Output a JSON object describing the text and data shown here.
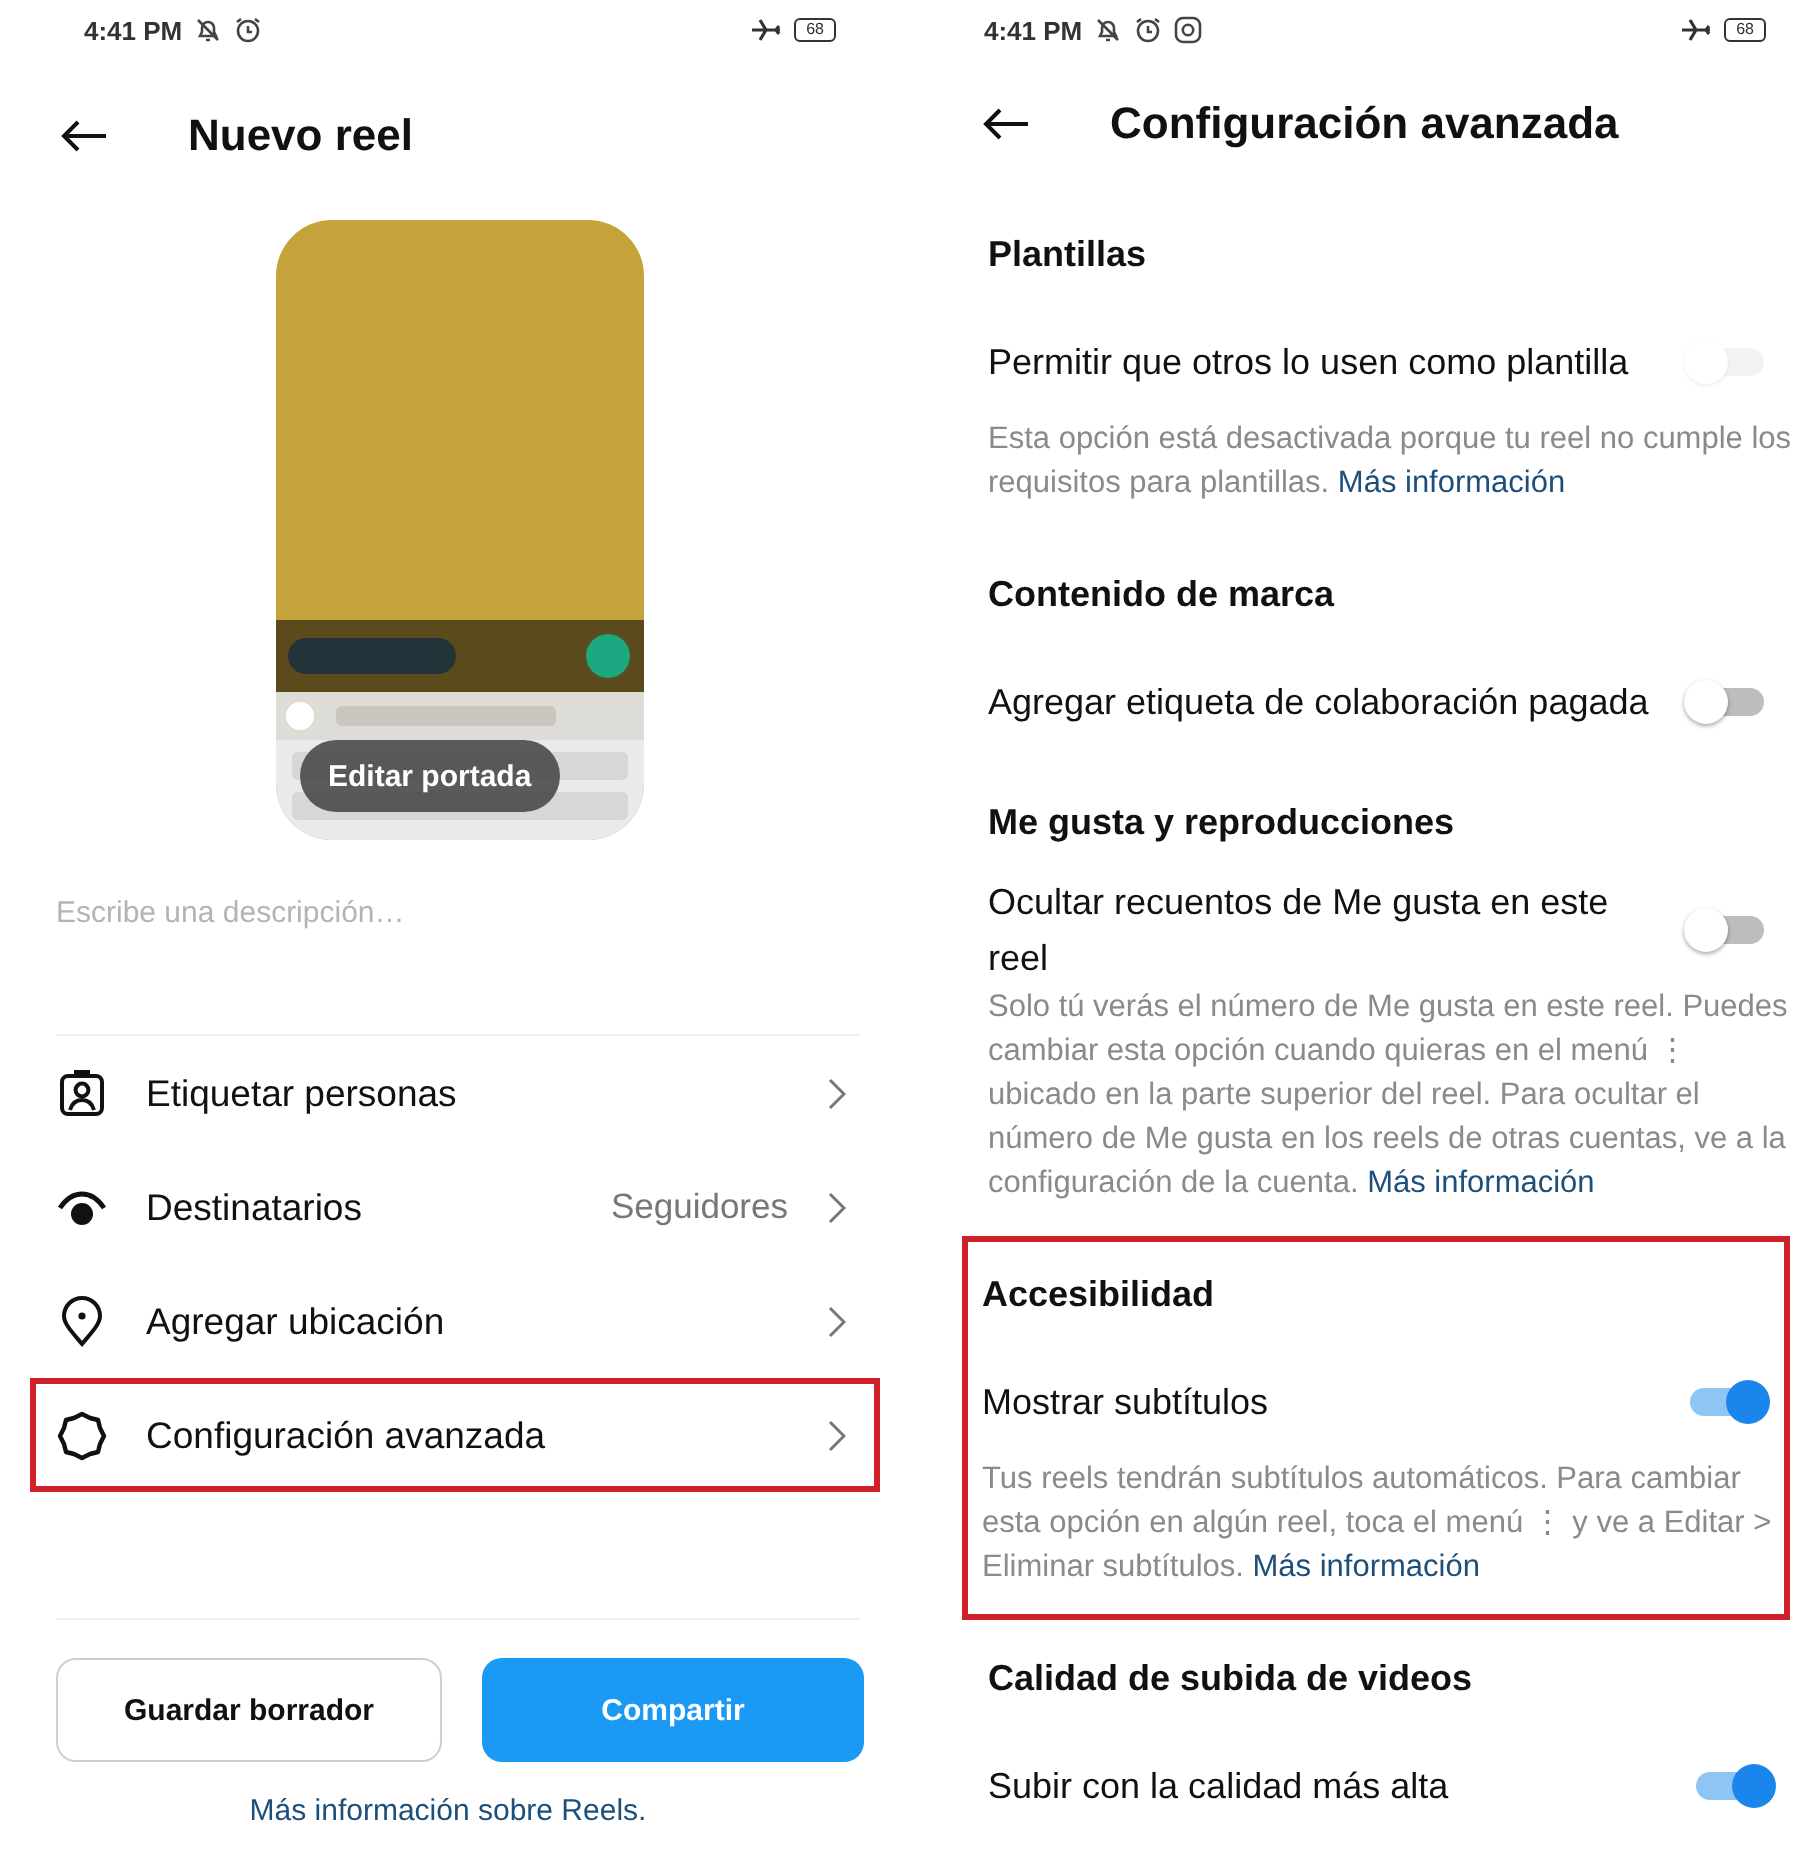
{
  "left": {
    "status_bar": {
      "time": "4:41 PM",
      "battery": "68"
    },
    "title": "Nuevo reel",
    "cover": {
      "kind": "picture",
      "button": "Editar portada"
    },
    "description": {
      "placeholder": "Escribe una descripción…"
    },
    "menu": [
      {
        "kind": "tag",
        "label": "Etiquetar personas",
        "highlighted": false
      },
      {
        "kind": "audience",
        "label": "Destinatarios",
        "value": "Seguidores",
        "highlighted": false
      },
      {
        "kind": "location",
        "label": "Agregar ubicación",
        "highlighted": false
      },
      {
        "kind": "advanced",
        "label": "Configuración avanzada",
        "highlighted": true
      }
    ],
    "buttons": [
      {
        "kind": "secondary",
        "label": "Guardar borrador"
      },
      {
        "kind": "primary",
        "label": "Compartir"
      }
    ],
    "footer_link": "Más información sobre Reels."
  },
  "right": {
    "status_bar": {
      "time": "4:41 PM",
      "battery": "68"
    },
    "title": "Configuración avanzada",
    "sections": [
      {
        "heading": "Plantillas",
        "highlighted": false,
        "settings": [
          {
            "label": "Permitir que otros lo usen como plantilla",
            "on": false,
            "disabled": true,
            "description": "Esta opción está desactivada porque tu reel no cumple los requisitos para plantillas.",
            "link": "Más información"
          }
        ]
      },
      {
        "heading": "Contenido de marca",
        "highlighted": false,
        "settings": [
          {
            "label": "Agregar etiqueta de colaboración pagada",
            "on": false,
            "disabled": false
          }
        ]
      },
      {
        "heading": "Me gusta y reproducciones",
        "highlighted": false,
        "settings": [
          {
            "label": "Ocultar recuentos de Me gusta en este reel",
            "on": false,
            "disabled": false,
            "description": "Solo tú verás el número de Me gusta en este reel. Puedes cambiar esta opción cuando quieras en el menú ⋮ ubicado en la parte superior del reel. Para ocultar el número de Me gusta en los reels de otras cuentas, ve a la configuración de la cuenta.",
            "link": "Más información"
          }
        ]
      },
      {
        "heading": "Accesibilidad",
        "highlighted": true,
        "settings": [
          {
            "label": "Mostrar subtítulos",
            "on": true,
            "disabled": false,
            "description": "Tus reels tendrán subtítulos automáticos. Para cambiar esta opción en algún reel, toca el menú ⋮ y ve a Editar > Eliminar subtítulos.",
            "link": "Más información"
          }
        ]
      },
      {
        "heading": "Calidad de subida de videos",
        "highlighted": false,
        "settings": [
          {
            "label": "Subir con la calidad más alta",
            "on": true,
            "disabled": false
          }
        ]
      }
    ]
  }
}
